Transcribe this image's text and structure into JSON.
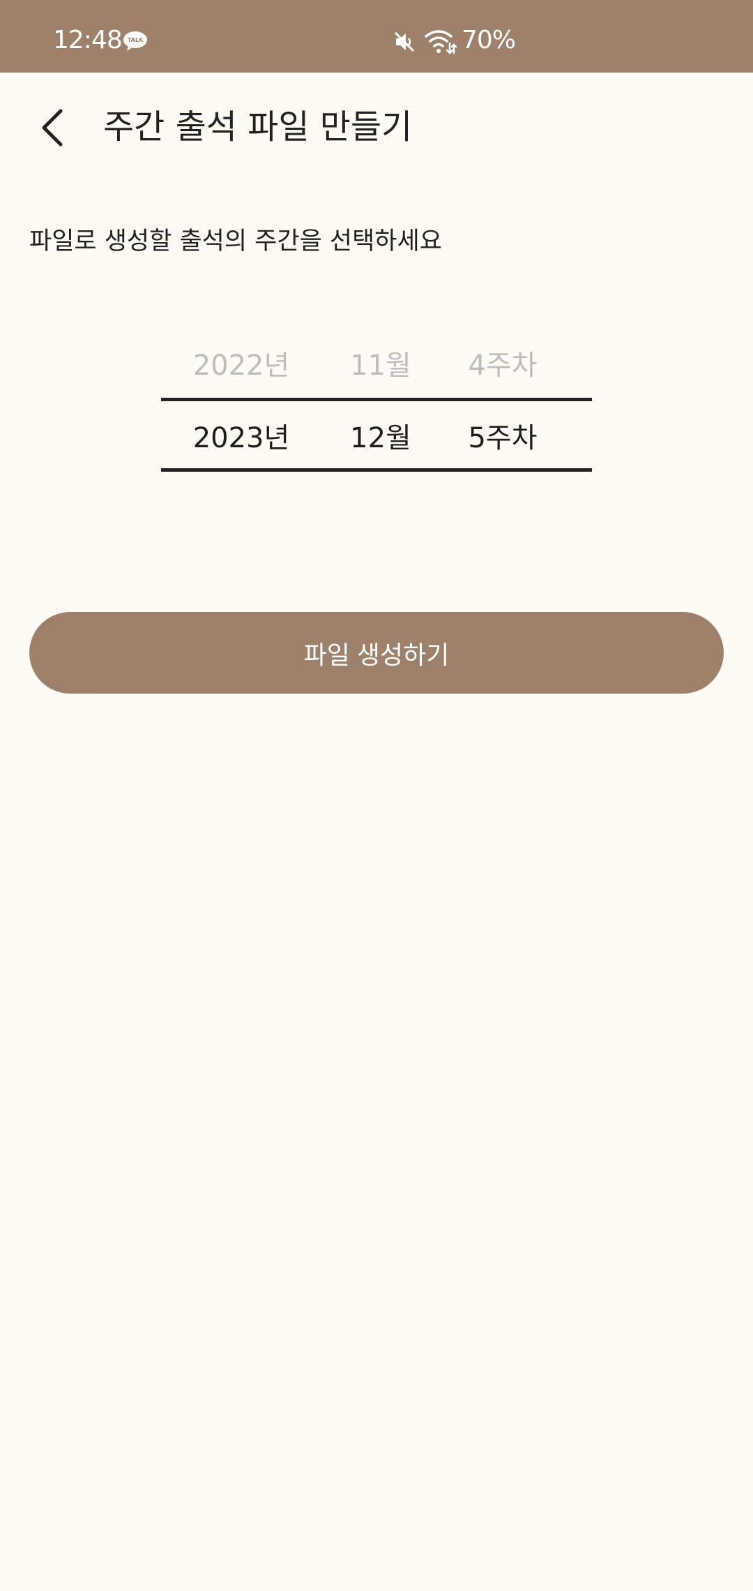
{
  "status_bar": {
    "time": "12:48",
    "notification_icon": "kakaotalk-icon",
    "notification_icon_text": "TALK",
    "sound_icon": "mute-icon",
    "wifi_icon": "wifi-icon",
    "battery": "70%"
  },
  "header": {
    "back_icon": "chevron-left-icon",
    "title": "주간 출석 파일 만들기"
  },
  "main": {
    "instruction": "파일로 생성할 출석의 주간을 선택하세요",
    "picker": {
      "previous": {
        "year": "2022년",
        "month": "11월",
        "week": "4주차"
      },
      "selected": {
        "year": "2023년",
        "month": "12월",
        "week": "5주차"
      }
    },
    "create_button_label": "파일 생성하기"
  },
  "colors": {
    "accent": "#9E816A",
    "background": "#FFFBF4",
    "text": "#1E1E1E",
    "muted_text": "#BDBDBD"
  }
}
